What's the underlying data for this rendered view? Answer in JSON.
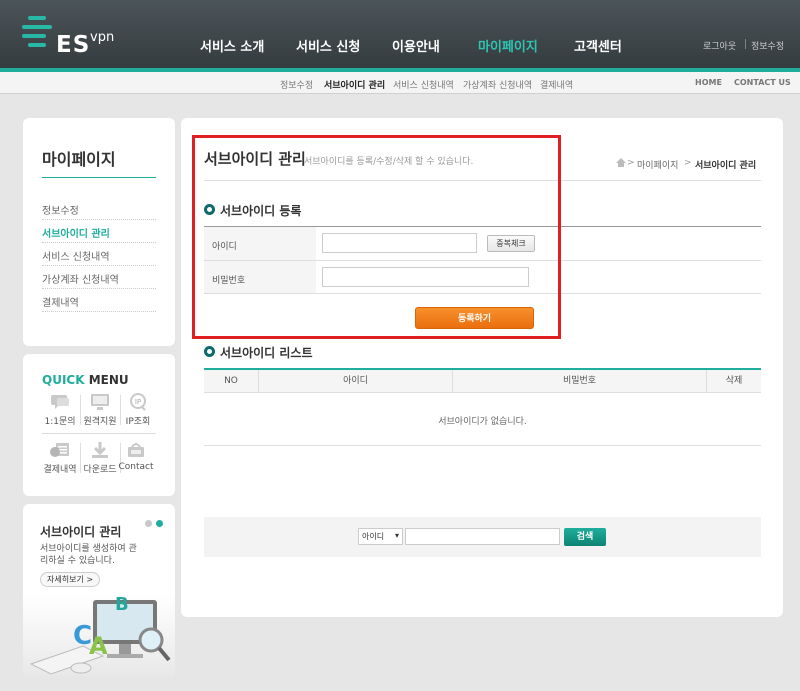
{
  "brand": {
    "logo_es": "ES",
    "logo_vpn": "vpn"
  },
  "gnb": [
    {
      "label": "서비스 소개"
    },
    {
      "label": "서비스 신청"
    },
    {
      "label": "이용안내"
    },
    {
      "label": "마이페이지",
      "active": true
    },
    {
      "label": "고객센터"
    }
  ],
  "util": {
    "logout": "로그아웃",
    "sub_edit": "정보수정"
  },
  "subnav": {
    "items": [
      "정보수정",
      "서브아이디 관리",
      "서비스 신청내역",
      "가상계좌 신청내역",
      "결제내역"
    ],
    "active_index": 1,
    "right": [
      "HOME",
      "CONTACT US"
    ]
  },
  "sidebar": {
    "title": "마이페이지",
    "items": [
      "정보수정",
      "서브아이디 관리",
      "서비스 신청내역",
      "가상계좌 신청내역",
      "결제내역"
    ],
    "active_index": 1
  },
  "quick_menu": {
    "title_a": "QUICK",
    "title_b": " MENU",
    "items": [
      {
        "label": "1:1문의",
        "icon": "chat-icon"
      },
      {
        "label": "원격지원",
        "icon": "monitor-icon"
      },
      {
        "label": "IP조회",
        "icon": "ip-icon"
      },
      {
        "label": "결제내역",
        "icon": "payment-icon"
      },
      {
        "label": "다운로드",
        "icon": "download-icon"
      },
      {
        "label": "Contact",
        "icon": "contact-icon"
      }
    ]
  },
  "promo": {
    "title": "서브아이디 관리",
    "desc": "서브아이디를 생성하여 관리하실 수 있습니다.",
    "button": "자세히보기 >"
  },
  "main": {
    "title": "서브아이디 관리",
    "desc": "서브아이디를 등록/수정/삭제 할 수 있습니다.",
    "breadcrumb": [
      "마이페이지",
      "서브아이디 관리"
    ],
    "register_section": "서브아이디 등록",
    "id_label": "아이디",
    "dup_check": "중복체크",
    "pw_label": "비밀번호",
    "register_button": "등록하기",
    "list_section": "서브아이디 리스트",
    "columns": [
      "NO",
      "아이디",
      "비밀번호",
      "삭제"
    ],
    "empty_message": "서브아이디가 없습니다.",
    "search_select": "아이디",
    "search_button": "검색"
  },
  "colors": {
    "accent": "#1fae9c",
    "header": "#3d4549",
    "highlight": "#e02020",
    "orange": "#f07d1b"
  }
}
